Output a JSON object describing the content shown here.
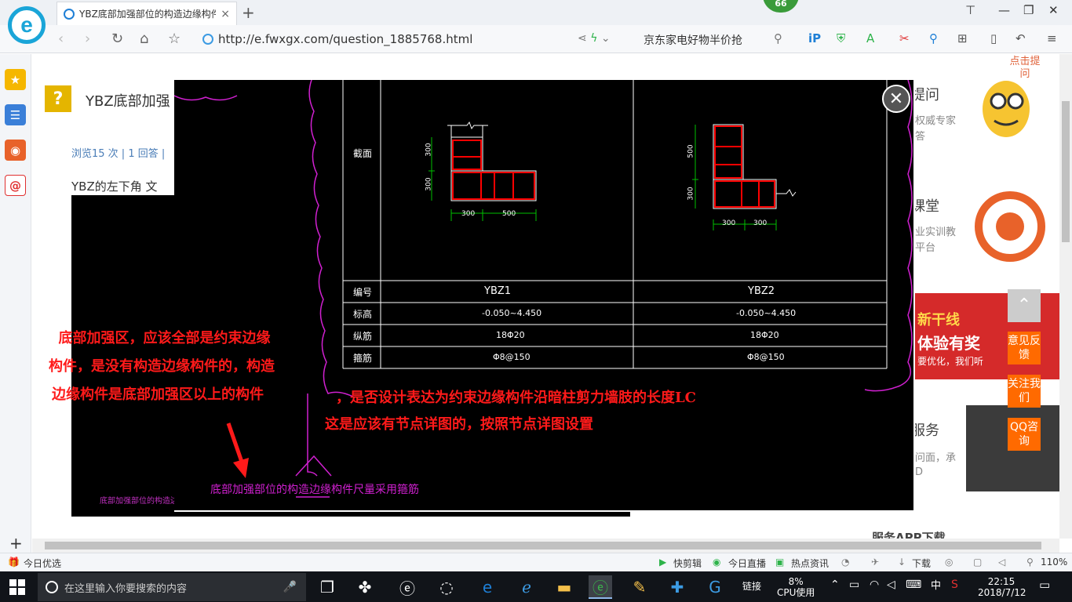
{
  "browser": {
    "tab_title": "YBZ底部加强部位的构造边缘构件",
    "tab_close": "×",
    "newtab": "+",
    "badge": "66",
    "url": "http://e.fwxgx.com/question_1885768.html",
    "search_text": "京东家电好物半价抢",
    "logo_letter": "e"
  },
  "page": {
    "question_title": "YBZ底部加强",
    "stats": "浏览15 次 | 1 回答 |",
    "question_text": "YBZ的左下角   文",
    "image_caption": "底部加强部位的构造边",
    "right": {
      "ask": "提问",
      "ask_sub": "权威专家",
      "ask_sub2": "答",
      "course": "课堂",
      "course_sub": "业实训教",
      "course_sub2": "平台",
      "promo_1": "新干线",
      "promo_2": "体验有奖",
      "promo_3": "要优化，我们听",
      "service": "服务",
      "service_sub": "问面，承",
      "service_sub2": "D",
      "app": "服务APP下载",
      "bubble": "点击提问"
    }
  },
  "drawing": {
    "row_section": "截面",
    "row_id": "编号",
    "row_elev": "标高",
    "row_long": "纵筋",
    "row_stirrup": "箍筋",
    "ybz1": {
      "id": "YBZ1",
      "elev": "-0.050~4.450",
      "long": "18Φ20",
      "stirrup": "Φ8@150",
      "d1": "300",
      "d2": "300",
      "w1": "300",
      "w2": "500"
    },
    "ybz2": {
      "id": "YBZ2",
      "elev": "-0.050~4.450",
      "long": "18Φ20",
      "stirrup": "Φ8@150",
      "d1": "500",
      "d2": "300",
      "w1": "300",
      "w2": "300"
    },
    "magenta_note": "底部加强部位的构造边缘构件尺量采用箍筋"
  },
  "notes": {
    "left_l1": "  底部加强区，应该全部是约束边缘",
    "left_l2": "构件，是没有构造边缘构件的，构造",
    "left_l3": "边缘构件是底部加强区以上的构件",
    "right_l1": "，是否设计表达为约束边缘构件沿暗柱剪力墙肢的长度LC",
    "right_l2": "这是应该有节点详图的，按照节点详图设置"
  },
  "float_buttons": {
    "feedback": "意见反馈",
    "follow": "关注我们",
    "qq": "QQ咨询"
  },
  "statusbar": {
    "today": "今日优选",
    "kuaijian": "快剪辑",
    "live": "今日直播",
    "news": "热点资讯",
    "download": "下载",
    "zoom": "110%"
  },
  "taskbar": {
    "search_placeholder": "在这里输入你要搜索的内容",
    "link": "链接",
    "cpu_pct": "8%",
    "cpu_label": "CPU使用",
    "ime": "中",
    "time": "22:15",
    "date": "2018/7/12"
  },
  "colors": {
    "accent_orange": "#ff6a00",
    "cad_green": "#00c000",
    "cad_red": "#ff0000",
    "cad_magenta": "#d020d0"
  }
}
